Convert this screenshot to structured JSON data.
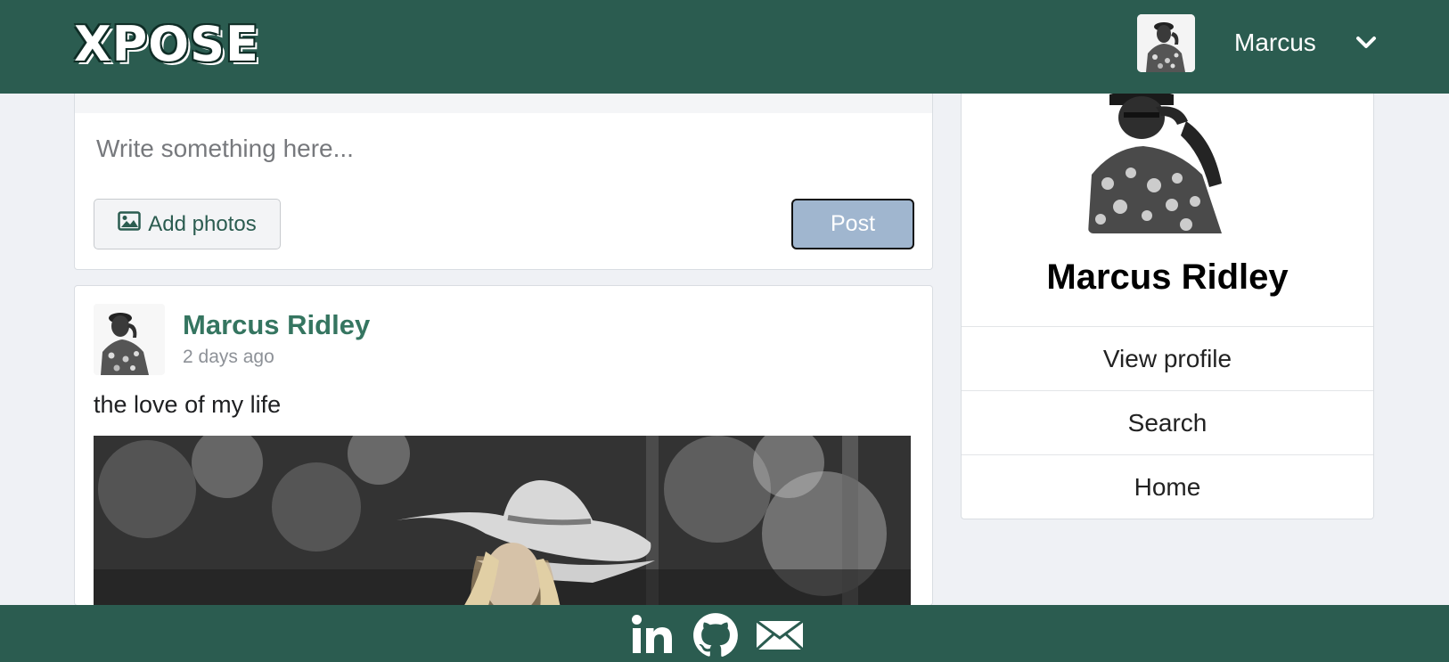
{
  "navbar": {
    "logo_text": "XPOSE",
    "username": "Marcus",
    "avatar_icon": "user-avatar-photo",
    "dropdown_icon": "chevron-down-icon"
  },
  "composer": {
    "placeholder": "Write something here...",
    "add_photos_label": "Add photos",
    "post_label": "Post"
  },
  "post": {
    "author": "Marcus Ridley",
    "time": "2 days ago",
    "text": "the love of my life"
  },
  "profile": {
    "name": "Marcus Ridley",
    "menu": [
      {
        "label": "View profile"
      },
      {
        "label": "Search"
      },
      {
        "label": "Home"
      }
    ]
  },
  "footer": {
    "icons": [
      "linkedin-icon",
      "github-icon",
      "email-icon"
    ]
  },
  "colors": {
    "brand_green": "#2b5c50",
    "author_link": "#357560",
    "post_button": "#a0b6cf",
    "page_background": "#eff1f5"
  }
}
